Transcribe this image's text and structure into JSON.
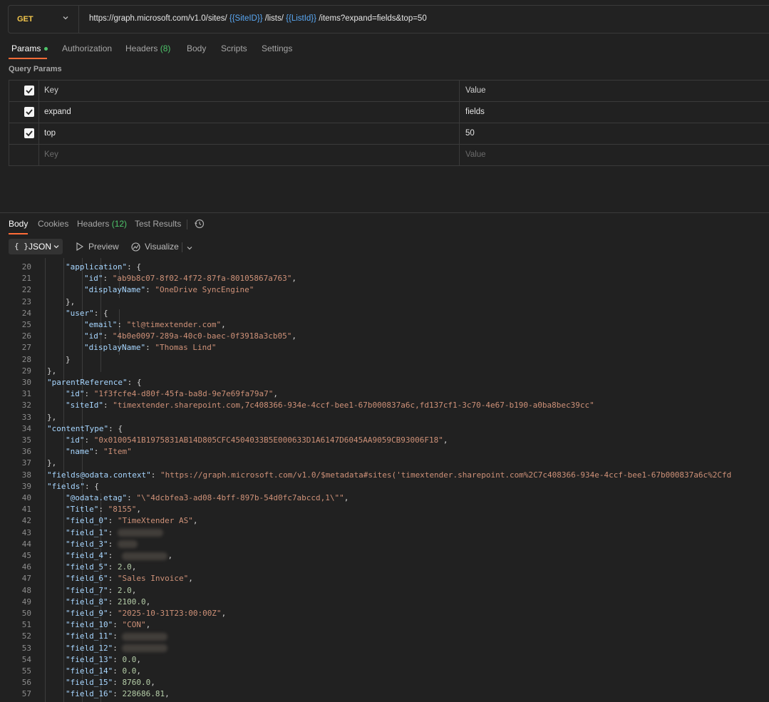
{
  "request": {
    "method": "GET",
    "url_parts": [
      {
        "text": "https://graph.microsoft.com/v1.0/sites/ ",
        "var": false
      },
      {
        "text": "{{SiteID}}",
        "var": true
      },
      {
        "text": " /lists/ ",
        "var": false
      },
      {
        "text": "{{ListId}}",
        "var": true
      },
      {
        "text": " /items?expand=fields&top=50",
        "var": false
      }
    ]
  },
  "request_tabs": {
    "params": "Params",
    "authorization": "Authorization",
    "headers": "Headers",
    "headers_count": "(8)",
    "body": "Body",
    "scripts": "Scripts",
    "settings": "Settings"
  },
  "query_params": {
    "label": "Query Params",
    "header": {
      "key": "Key",
      "value": "Value"
    },
    "rows": [
      {
        "key": "expand",
        "value": "fields"
      },
      {
        "key": "top",
        "value": "50"
      }
    ],
    "placeholder": {
      "key": "Key",
      "value": "Value"
    }
  },
  "response_tabs": {
    "body": "Body",
    "cookies": "Cookies",
    "headers": "Headers",
    "headers_count": "(12)",
    "test_results": "Test Results"
  },
  "toolbar": {
    "format": "JSON",
    "preview": "Preview",
    "visualize": "Visualize"
  },
  "code_lines": [
    {
      "n": "20",
      "indent": 6,
      "html": [
        [
          "key",
          "\"application\""
        ],
        [
          "p",
          ": {"
        ]
      ]
    },
    {
      "n": "21",
      "indent": 7,
      "html": [
        [
          "key",
          "\"id\""
        ],
        [
          "p",
          ": "
        ],
        [
          "s",
          "\"ab9b8c07-8f02-4f72-87fa-80105867a763\""
        ],
        [
          "p",
          ","
        ]
      ]
    },
    {
      "n": "22",
      "indent": 7,
      "html": [
        [
          "key",
          "\"displayName\""
        ],
        [
          "p",
          ": "
        ],
        [
          "s",
          "\"OneDrive SyncEngine\""
        ]
      ]
    },
    {
      "n": "23",
      "indent": 6,
      "html": [
        [
          "p",
          "},"
        ]
      ]
    },
    {
      "n": "24",
      "indent": 6,
      "html": [
        [
          "key",
          "\"user\""
        ],
        [
          "p",
          ": {"
        ]
      ]
    },
    {
      "n": "25",
      "indent": 7,
      "html": [
        [
          "key",
          "\"email\""
        ],
        [
          "p",
          ": "
        ],
        [
          "s",
          "\"tl@timextender.com\""
        ],
        [
          "p",
          ","
        ]
      ]
    },
    {
      "n": "26",
      "indent": 7,
      "html": [
        [
          "key",
          "\"id\""
        ],
        [
          "p",
          ": "
        ],
        [
          "s",
          "\"4b0e0097-289a-40c0-baec-0f3918a3cb05\""
        ],
        [
          "p",
          ","
        ]
      ]
    },
    {
      "n": "27",
      "indent": 7,
      "html": [
        [
          "key",
          "\"displayName\""
        ],
        [
          "p",
          ": "
        ],
        [
          "s",
          "\"Thomas Lind\""
        ]
      ]
    },
    {
      "n": "28",
      "indent": 6,
      "html": [
        [
          "p",
          "}"
        ]
      ]
    },
    {
      "n": "29",
      "indent": 5,
      "html": [
        [
          "p",
          "},"
        ]
      ]
    },
    {
      "n": "30",
      "indent": 5,
      "html": [
        [
          "key",
          "\"parentReference\""
        ],
        [
          "p",
          ": {"
        ]
      ]
    },
    {
      "n": "31",
      "indent": 6,
      "html": [
        [
          "key",
          "\"id\""
        ],
        [
          "p",
          ": "
        ],
        [
          "s",
          "\"1f3fcfe4-d80f-45fa-ba8d-9e7e69fa79a7\""
        ],
        [
          "p",
          ","
        ]
      ]
    },
    {
      "n": "32",
      "indent": 6,
      "html": [
        [
          "key",
          "\"siteId\""
        ],
        [
          "p",
          ": "
        ],
        [
          "s",
          "\"timextender.sharepoint.com,7c408366-934e-4ccf-bee1-67b000837a6c,fd137cf1-3c70-4e67-b190-a0ba8bec39cc\""
        ]
      ]
    },
    {
      "n": "33",
      "indent": 5,
      "html": [
        [
          "p",
          "},"
        ]
      ]
    },
    {
      "n": "34",
      "indent": 5,
      "html": [
        [
          "key",
          "\"contentType\""
        ],
        [
          "p",
          ": {"
        ]
      ]
    },
    {
      "n": "35",
      "indent": 6,
      "html": [
        [
          "key",
          "\"id\""
        ],
        [
          "p",
          ": "
        ],
        [
          "s",
          "\"0x0100541B1975831AB14D805CFC4504033B5E000633D1A6147D6045AA9059CB93006F18\""
        ],
        [
          "p",
          ","
        ]
      ]
    },
    {
      "n": "36",
      "indent": 6,
      "html": [
        [
          "key",
          "\"name\""
        ],
        [
          "p",
          ": "
        ],
        [
          "s",
          "\"Item\""
        ]
      ]
    },
    {
      "n": "37",
      "indent": 5,
      "html": [
        [
          "p",
          "},"
        ]
      ]
    },
    {
      "n": "38",
      "indent": 5,
      "html": [
        [
          "key",
          "\"fields@odata.context\""
        ],
        [
          "p",
          ": "
        ],
        [
          "s",
          "\"https://graph.microsoft.com/v1.0/$metadata#sites('timextender.sharepoint.com%2C7c408366-934e-4ccf-bee1-67b000837a6c%2Cfd"
        ]
      ]
    },
    {
      "n": "39",
      "indent": 5,
      "html": [
        [
          "key",
          "\"fields\""
        ],
        [
          "p",
          ": {"
        ]
      ]
    },
    {
      "n": "40",
      "indent": 6,
      "html": [
        [
          "key",
          "\"@odata.etag\""
        ],
        [
          "p",
          ": "
        ],
        [
          "s",
          "\"\\\"4dcbfea3-ad08-4bff-897b-54d0fc7abccd,1\\\"\""
        ],
        [
          "p",
          ","
        ]
      ]
    },
    {
      "n": "41",
      "indent": 6,
      "html": [
        [
          "key",
          "\"Title\""
        ],
        [
          "p",
          ": "
        ],
        [
          "s",
          "\"8155\""
        ],
        [
          "p",
          ","
        ]
      ]
    },
    {
      "n": "42",
      "indent": 6,
      "html": [
        [
          "key",
          "\"field_0\""
        ],
        [
          "p",
          ": "
        ],
        [
          "s",
          "\"TimeXtender AS\""
        ],
        [
          "p",
          ","
        ]
      ]
    },
    {
      "n": "43",
      "indent": 6,
      "html": [
        [
          "key",
          "\"field_1\""
        ],
        [
          "p",
          ": "
        ],
        [
          "blur",
          ""
        ]
      ]
    },
    {
      "n": "44",
      "indent": 6,
      "html": [
        [
          "key",
          "\"field_3\""
        ],
        [
          "p",
          ": "
        ],
        [
          "blursm",
          ""
        ]
      ]
    },
    {
      "n": "45",
      "indent": 6,
      "html": [
        [
          "key",
          "\"field_4\""
        ],
        [
          "p",
          ":  "
        ],
        [
          "blur",
          ""
        ],
        [
          "p",
          ","
        ]
      ]
    },
    {
      "n": "46",
      "indent": 6,
      "html": [
        [
          "key",
          "\"field_5\""
        ],
        [
          "p",
          ": "
        ],
        [
          "n",
          "2.0"
        ],
        [
          "p",
          ","
        ]
      ]
    },
    {
      "n": "47",
      "indent": 6,
      "html": [
        [
          "key",
          "\"field_6\""
        ],
        [
          "p",
          ": "
        ],
        [
          "s",
          "\"Sales Invoice\""
        ],
        [
          "p",
          ","
        ]
      ]
    },
    {
      "n": "48",
      "indent": 6,
      "html": [
        [
          "key",
          "\"field_7\""
        ],
        [
          "p",
          ": "
        ],
        [
          "n",
          "2.0"
        ],
        [
          "p",
          ","
        ]
      ]
    },
    {
      "n": "49",
      "indent": 6,
      "html": [
        [
          "key",
          "\"field_8\""
        ],
        [
          "p",
          ": "
        ],
        [
          "n",
          "2100.0"
        ],
        [
          "p",
          ","
        ]
      ]
    },
    {
      "n": "50",
      "indent": 6,
      "html": [
        [
          "key",
          "\"field_9\""
        ],
        [
          "p",
          ": "
        ],
        [
          "s",
          "\"2025-10-31T23:00:00Z\""
        ],
        [
          "p",
          ","
        ]
      ]
    },
    {
      "n": "51",
      "indent": 6,
      "html": [
        [
          "key",
          "\"field_10\""
        ],
        [
          "p",
          ": "
        ],
        [
          "s",
          "\"CON\""
        ],
        [
          "p",
          ","
        ]
      ]
    },
    {
      "n": "52",
      "indent": 6,
      "html": [
        [
          "key",
          "\"field_11\""
        ],
        [
          "p",
          ": "
        ],
        [
          "blur",
          ""
        ]
      ]
    },
    {
      "n": "53",
      "indent": 6,
      "html": [
        [
          "key",
          "\"field_12\""
        ],
        [
          "p",
          ": "
        ],
        [
          "blur",
          ""
        ]
      ]
    },
    {
      "n": "54",
      "indent": 6,
      "html": [
        [
          "key",
          "\"field_13\""
        ],
        [
          "p",
          ": "
        ],
        [
          "n",
          "0.0"
        ],
        [
          "p",
          ","
        ]
      ]
    },
    {
      "n": "55",
      "indent": 6,
      "html": [
        [
          "key",
          "\"field_14\""
        ],
        [
          "p",
          ": "
        ],
        [
          "n",
          "0.0"
        ],
        [
          "p",
          ","
        ]
      ]
    },
    {
      "n": "56",
      "indent": 6,
      "html": [
        [
          "key",
          "\"field_15\""
        ],
        [
          "p",
          ": "
        ],
        [
          "n",
          "8760.0"
        ],
        [
          "p",
          ","
        ]
      ]
    },
    {
      "n": "57",
      "indent": 6,
      "html": [
        [
          "key",
          "\"field_16\""
        ],
        [
          "p",
          ": "
        ],
        [
          "n",
          "228686.81"
        ],
        [
          "p",
          ","
        ]
      ]
    }
  ],
  "colors": {
    "accent": "#ff6c37",
    "method": "#f2c64c",
    "variable": "#5aa9f5",
    "count": "#4ec46a",
    "json_key": "#a7d6ff",
    "json_string": "#ce9178",
    "json_number": "#b5cea8"
  }
}
